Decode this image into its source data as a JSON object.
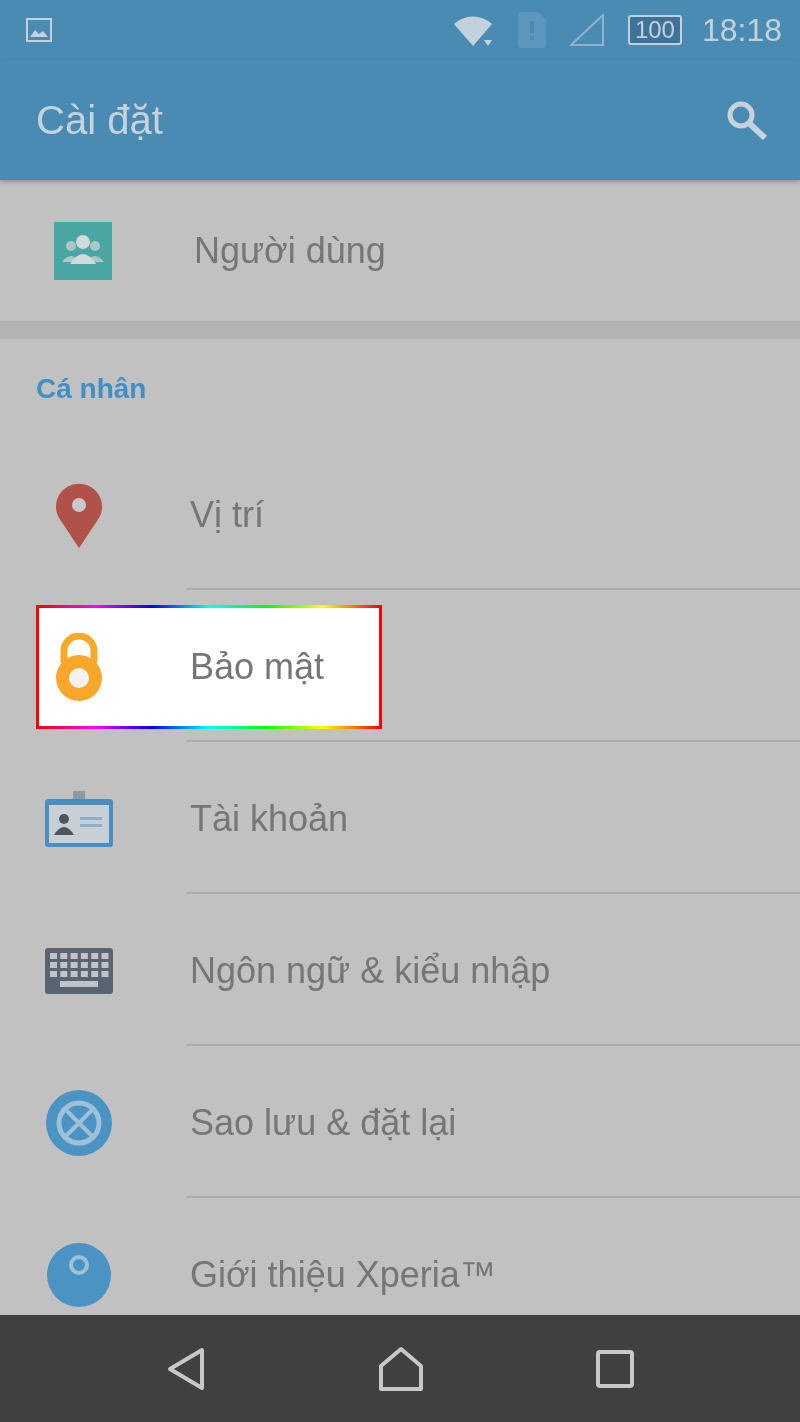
{
  "status_bar": {
    "battery": "100",
    "time": "18:18"
  },
  "app_bar": {
    "title": "Cài đặt"
  },
  "top_items": [
    {
      "kind": "users",
      "label": "Người dùng",
      "highlighted": false
    }
  ],
  "sections": [
    {
      "header": "Cá nhân",
      "items": [
        {
          "kind": "location",
          "label": "Vị trí",
          "highlighted": false
        },
        {
          "kind": "lock",
          "label": "Bảo mật",
          "highlighted": true
        },
        {
          "kind": "account",
          "label": "Tài khoản",
          "highlighted": false
        },
        {
          "kind": "keyboard",
          "label": "Ngôn ngữ & kiểu nhập",
          "highlighted": false
        },
        {
          "kind": "backup",
          "label": "Sao lưu & đặt lại",
          "highlighted": false
        },
        {
          "kind": "info",
          "label": "Giới thiệu Xperia™",
          "highlighted": false
        }
      ]
    }
  ]
}
